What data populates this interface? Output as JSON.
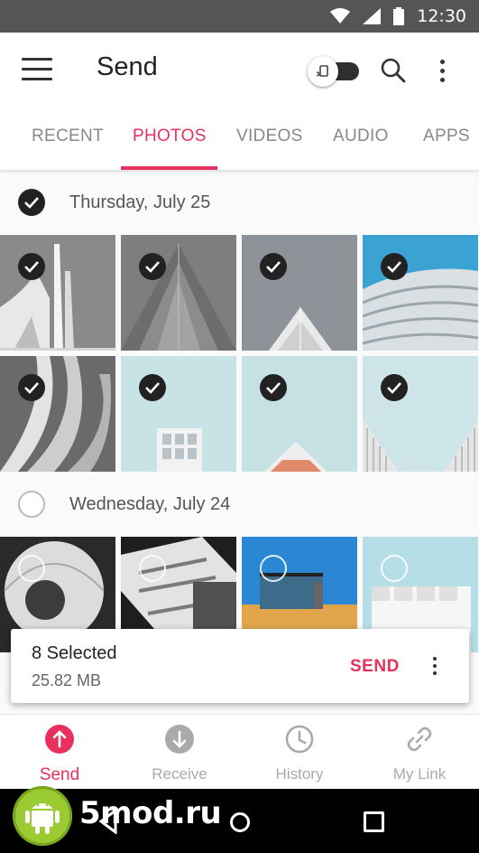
{
  "status_bar": {
    "time": "12:30",
    "icons": [
      "wifi-icon",
      "signal-icon",
      "battery-icon"
    ]
  },
  "app_bar": {
    "title": "Send",
    "icons": [
      "menu-icon",
      "cast-toggle-icon",
      "search-icon",
      "more-vert-icon"
    ]
  },
  "tabs": [
    {
      "label": "RECENT",
      "active": false
    },
    {
      "label": "PHOTOS",
      "active": true
    },
    {
      "label": "VIDEOS",
      "active": false
    },
    {
      "label": "AUDIO",
      "active": false
    },
    {
      "label": "APPS",
      "active": false
    }
  ],
  "groups": [
    {
      "date": "Thursday, July 25",
      "all_selected": true,
      "photos_selected": [
        true,
        true,
        true,
        true,
        true,
        true,
        true,
        true
      ]
    },
    {
      "date": "Wednesday, July 24",
      "all_selected": false,
      "photos_selected": [
        false,
        false,
        false,
        false
      ]
    }
  ],
  "selection": {
    "count_label": "8 Selected",
    "size_label": "25.82 MB",
    "send_label": "SEND"
  },
  "bottom_nav": [
    {
      "label": "Send",
      "icon": "upload-icon",
      "active": true
    },
    {
      "label": "Receive",
      "icon": "download-icon",
      "active": false
    },
    {
      "label": "History",
      "icon": "clock-icon",
      "active": false
    },
    {
      "label": "My Link",
      "icon": "link-icon",
      "active": false
    }
  ],
  "watermark": {
    "text": "5mod.ru",
    "logo": "android-logo"
  },
  "colors": {
    "accent": "#e8305e",
    "status_bar": "#555555",
    "system_nav": "#000000"
  }
}
